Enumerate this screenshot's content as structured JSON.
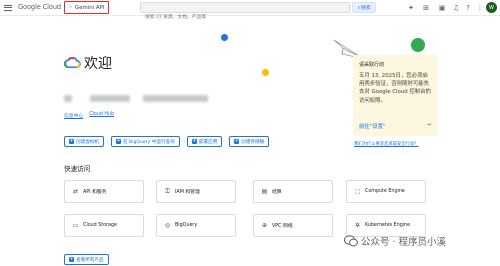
{
  "header": {
    "logo_text": "Google Cloud",
    "project_label": "Gemini API",
    "search_placeholder": "搜索 (/) 资源、文档、产品等",
    "search_button": "搜索",
    "avatar_letter": "W"
  },
  "welcome": {
    "title": "欢迎"
  },
  "links": {
    "dashboard": "信息中心",
    "cloud_hub": "Cloud Hub"
  },
  "actions": [
    {
      "label": "创建虚拟机"
    },
    {
      "label": "在 BigQuery 中运行查询"
    },
    {
      "label": "部署应用"
    },
    {
      "label": "创建存储桶"
    }
  ],
  "notice_card": {
    "title": "请采取行动",
    "body": "五月 13, 2025日，您必须启用两步验证，否则随时可能失去对 Google Cloud 控制台的访问权限。",
    "cta": "前往\"设置\"",
    "link": "我们为什么要求您采取安全行动？"
  },
  "quick_access": {
    "title": "快速访问",
    "tiles": [
      {
        "label": "API 和服务",
        "icon": "api-icon"
      },
      {
        "label": "IAM 和管理",
        "icon": "iam-icon"
      },
      {
        "label": "结算",
        "icon": "billing-icon"
      },
      {
        "label": "Compute Engine",
        "icon": "compute-engine-icon"
      },
      {
        "label": "Cloud Storage",
        "icon": "cloud-storage-icon"
      },
      {
        "label": "BigQuery",
        "icon": "bigquery-icon"
      },
      {
        "label": "VPC 网络",
        "icon": "vpc-network-icon"
      },
      {
        "label": "Kubernetes Engine",
        "icon": "kubernetes-engine-icon"
      }
    ],
    "more_button": "查看所有产品"
  },
  "watermark": {
    "text": "公众号 · 程序员小溪"
  },
  "colors": {
    "accent": "#1a73e8",
    "card_bg": "#fef7e0",
    "highlight_border": "#d93025"
  }
}
